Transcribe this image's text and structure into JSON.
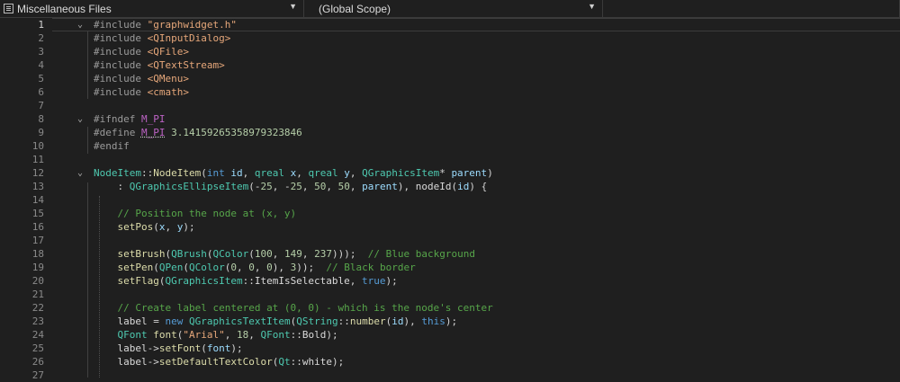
{
  "toolbar": {
    "file_dropdown": "Miscellaneous Files",
    "scope_dropdown": "(Global Scope)",
    "third_dropdown": ""
  },
  "editor": {
    "current_line": 1,
    "lines": [
      {
        "n": "1",
        "t": [
          [
            "pp",
            "#include "
          ],
          [
            "str",
            "\"graphwidget.h\""
          ]
        ]
      },
      {
        "n": "2",
        "t": [
          [
            "pp",
            "#include "
          ],
          [
            "inc",
            "<QInputDialog>"
          ]
        ]
      },
      {
        "n": "3",
        "t": [
          [
            "pp",
            "#include "
          ],
          [
            "inc",
            "<QFile>"
          ]
        ]
      },
      {
        "n": "4",
        "t": [
          [
            "pp",
            "#include "
          ],
          [
            "inc",
            "<QTextStream>"
          ]
        ]
      },
      {
        "n": "5",
        "t": [
          [
            "pp",
            "#include "
          ],
          [
            "inc",
            "<QMenu>"
          ]
        ]
      },
      {
        "n": "6",
        "t": [
          [
            "pp",
            "#include "
          ],
          [
            "inc",
            "<cmath>"
          ]
        ]
      },
      {
        "n": "7",
        "t": []
      },
      {
        "n": "8",
        "t": [
          [
            "pp",
            "#ifndef "
          ],
          [
            "mac",
            "M_PI"
          ]
        ]
      },
      {
        "n": "9",
        "t": [
          [
            "pp",
            "#define "
          ],
          [
            "mac sq",
            "M_PI"
          ],
          [
            "num",
            " 3.14159265358979323846"
          ]
        ]
      },
      {
        "n": "10",
        "t": [
          [
            "pp",
            "#endif"
          ]
        ]
      },
      {
        "n": "11",
        "t": []
      },
      {
        "n": "12",
        "t": [
          [
            "ty",
            "NodeItem"
          ],
          [
            "",
            "::"
          ],
          [
            "fn",
            "NodeItem"
          ],
          [
            "",
            "("
          ],
          [
            "kw",
            "int"
          ],
          [
            "prm",
            " id"
          ],
          [
            "",
            ", "
          ],
          [
            "ty",
            "qreal"
          ],
          [
            "prm",
            " x"
          ],
          [
            "",
            ", "
          ],
          [
            "ty",
            "qreal"
          ],
          [
            "prm",
            " y"
          ],
          [
            "",
            ", "
          ],
          [
            "ty",
            "QGraphicsItem"
          ],
          [
            "",
            "* "
          ],
          [
            "prm",
            "parent"
          ],
          [
            "",
            ")"
          ]
        ]
      },
      {
        "n": "13",
        "t": [
          [
            "",
            "    : "
          ],
          [
            "ty",
            "QGraphicsEllipseItem"
          ],
          [
            "",
            "(-"
          ],
          [
            "num",
            "25"
          ],
          [
            "",
            ", -"
          ],
          [
            "num",
            "25"
          ],
          [
            "",
            ", "
          ],
          [
            "num",
            "50"
          ],
          [
            "",
            ", "
          ],
          [
            "num",
            "50"
          ],
          [
            "",
            ", "
          ],
          [
            "prm",
            "parent"
          ],
          [
            "",
            "), "
          ],
          [
            "mem",
            "nodeId"
          ],
          [
            "",
            "("
          ],
          [
            "prm",
            "id"
          ],
          [
            "",
            ") {"
          ]
        ]
      },
      {
        "n": "14",
        "t": []
      },
      {
        "n": "15",
        "t": [
          [
            "",
            "    "
          ],
          [
            "cm",
            "// Position the node at (x, y)"
          ]
        ]
      },
      {
        "n": "16",
        "t": [
          [
            "",
            "    "
          ],
          [
            "fn",
            "setPos"
          ],
          [
            "",
            "("
          ],
          [
            "prm",
            "x"
          ],
          [
            "",
            ", "
          ],
          [
            "prm",
            "y"
          ],
          [
            "",
            ");"
          ]
        ]
      },
      {
        "n": "17",
        "t": []
      },
      {
        "n": "18",
        "t": [
          [
            "",
            "    "
          ],
          [
            "fn",
            "setBrush"
          ],
          [
            "",
            "("
          ],
          [
            "ty",
            "QBrush"
          ],
          [
            "",
            "("
          ],
          [
            "ty",
            "QColor"
          ],
          [
            "",
            "("
          ],
          [
            "num",
            "100"
          ],
          [
            "",
            ", "
          ],
          [
            "num",
            "149"
          ],
          [
            "",
            ", "
          ],
          [
            "num",
            "237"
          ],
          [
            "",
            ")));  "
          ],
          [
            "cm",
            "// Blue background"
          ]
        ]
      },
      {
        "n": "19",
        "t": [
          [
            "",
            "    "
          ],
          [
            "fn",
            "setPen"
          ],
          [
            "",
            "("
          ],
          [
            "ty",
            "QPen"
          ],
          [
            "",
            "("
          ],
          [
            "ty",
            "QColor"
          ],
          [
            "",
            "("
          ],
          [
            "num",
            "0"
          ],
          [
            "",
            ", "
          ],
          [
            "num",
            "0"
          ],
          [
            "",
            ", "
          ],
          [
            "num",
            "0"
          ],
          [
            "",
            "), "
          ],
          [
            "num",
            "3"
          ],
          [
            "",
            "));  "
          ],
          [
            "cm",
            "// Black border"
          ]
        ]
      },
      {
        "n": "20",
        "t": [
          [
            "",
            "    "
          ],
          [
            "fn",
            "setFlag"
          ],
          [
            "",
            "("
          ],
          [
            "ty",
            "QGraphicsItem"
          ],
          [
            "",
            "::"
          ],
          [
            "mem",
            "ItemIsSelectable"
          ],
          [
            "",
            ", "
          ],
          [
            "kw",
            "true"
          ],
          [
            "",
            ");"
          ]
        ]
      },
      {
        "n": "21",
        "t": []
      },
      {
        "n": "22",
        "t": [
          [
            "",
            "    "
          ],
          [
            "cm",
            "// Create label centered at (0, 0) - which is the node's center"
          ]
        ]
      },
      {
        "n": "23",
        "t": [
          [
            "",
            "    "
          ],
          [
            "mem",
            "label"
          ],
          [
            "",
            " = "
          ],
          [
            "kw",
            "new "
          ],
          [
            "ty",
            "QGraphicsTextItem"
          ],
          [
            "",
            "("
          ],
          [
            "ty",
            "QString"
          ],
          [
            "",
            "::"
          ],
          [
            "fn",
            "number"
          ],
          [
            "",
            "("
          ],
          [
            "prm",
            "id"
          ],
          [
            "",
            "), "
          ],
          [
            "kw",
            "this"
          ],
          [
            "",
            ");"
          ]
        ]
      },
      {
        "n": "24",
        "t": [
          [
            "",
            "    "
          ],
          [
            "ty",
            "QFont"
          ],
          [
            "",
            " "
          ],
          [
            "fn",
            "font"
          ],
          [
            "",
            "("
          ],
          [
            "str",
            "\"Arial\""
          ],
          [
            "",
            ", "
          ],
          [
            "num",
            "18"
          ],
          [
            "",
            ", "
          ],
          [
            "ty",
            "QFont"
          ],
          [
            "",
            "::"
          ],
          [
            "mem",
            "Bold"
          ],
          [
            "",
            ");"
          ]
        ]
      },
      {
        "n": "25",
        "t": [
          [
            "",
            "    "
          ],
          [
            "mem",
            "label"
          ],
          [
            "",
            "->"
          ],
          [
            "fn",
            "setFont"
          ],
          [
            "",
            "("
          ],
          [
            "prm",
            "font"
          ],
          [
            "",
            ");"
          ]
        ]
      },
      {
        "n": "26",
        "t": [
          [
            "",
            "    "
          ],
          [
            "mem",
            "label"
          ],
          [
            "",
            "->"
          ],
          [
            "fn",
            "setDefaultTextColor"
          ],
          [
            "",
            "("
          ],
          [
            "ty",
            "Qt"
          ],
          [
            "",
            "::"
          ],
          [
            "mem",
            "white"
          ],
          [
            "",
            ");"
          ]
        ]
      },
      {
        "n": "27",
        "t": []
      }
    ]
  }
}
